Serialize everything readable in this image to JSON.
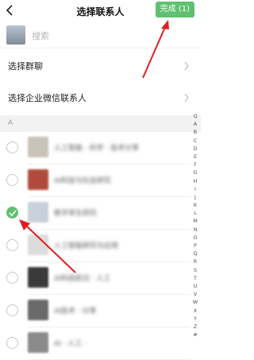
{
  "header": {
    "title": "选择联系人",
    "done_label": "完成 (1)"
  },
  "search": {
    "placeholder": "搜索"
  },
  "nav": [
    {
      "label": "选择群聊"
    },
    {
      "label": "选择企业微信联系人"
    }
  ],
  "section_letter": "A",
  "contacts": [
    {
      "name": "人工智能 · 科学 · 技术分享",
      "checked": false,
      "avatar_color": "#c9c2b8"
    },
    {
      "name": "AI科技与社会研究",
      "checked": false,
      "avatar_color": "#b04a3a"
    },
    {
      "name": "数字孪生研究",
      "checked": true,
      "avatar_color": "#c8d0da"
    },
    {
      "name": "人工智能研究与应用",
      "checked": false,
      "avatar_color": "#dcdcdc"
    },
    {
      "name": "AI科技前沿 · 人工",
      "checked": false,
      "avatar_color": "#3a3a3a"
    },
    {
      "name": "AI技术 · 分享",
      "checked": false,
      "avatar_color": "#6a6a6a"
    },
    {
      "name": "AI · 人工 ·",
      "checked": false,
      "avatar_color": "#8a8a8a"
    }
  ],
  "index_letters": [
    "Q",
    "A",
    "B",
    "C",
    "D",
    "E",
    "F",
    "G",
    "H",
    "I",
    "J",
    "K",
    "L",
    "M",
    "N",
    "O",
    "P",
    "Q",
    "R",
    "S",
    "T",
    "U",
    "V",
    "W",
    "X",
    "Y",
    "Z",
    "#"
  ],
  "colors": {
    "accent": "#5fc16f",
    "annotation": "#e02020"
  }
}
